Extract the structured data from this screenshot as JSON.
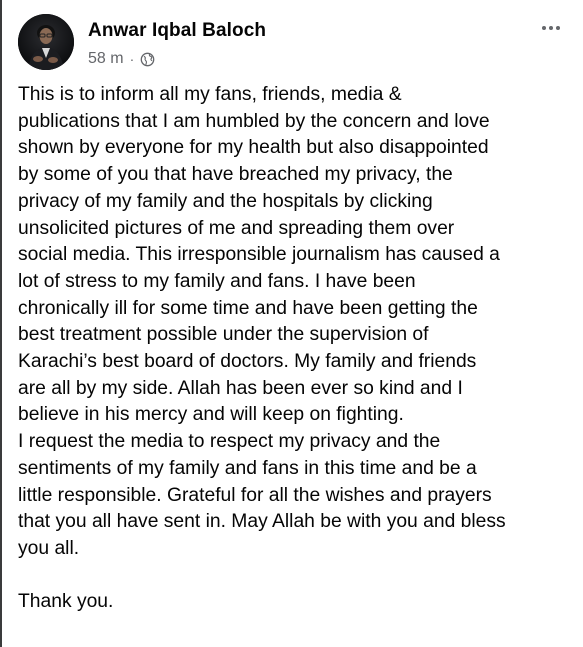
{
  "post": {
    "author": "Anwar Iqbal Baloch",
    "timestamp": "58 m",
    "separator": "·",
    "privacy_icon": "globe-icon",
    "more_icon": "more-horizontal-icon",
    "avatar_icon": "profile-photo",
    "body": "This is to inform all my fans, friends, media &\npublications that I am humbled by the concern and love\nshown by everyone for my health but also disappointed\nby some of you that have breached my privacy, the\nprivacy of my family and the hospitals by clicking\nunsolicited pictures of me and spreading them over\nsocial media. This irresponsible journalism has caused a\nlot of stress to my family and fans. I have been\nchronically ill for some time and have been getting the\nbest treatment possible under the supervision of\nKarachi’s best board of doctors. My family and friends\nare all by my side. Allah has been ever so kind and I\nbelieve in his mercy and will keep on fighting.\nI request the media to respect my privacy and the\nsentiments of my family and fans in this time and be a\nlittle responsible. Grateful for all the wishes and prayers\nthat you all have sent in. May Allah be with you and bless\nyou all.\n\nThank you."
  },
  "colors": {
    "text_primary": "#050505",
    "text_secondary": "#65676b",
    "background": "#ffffff"
  }
}
